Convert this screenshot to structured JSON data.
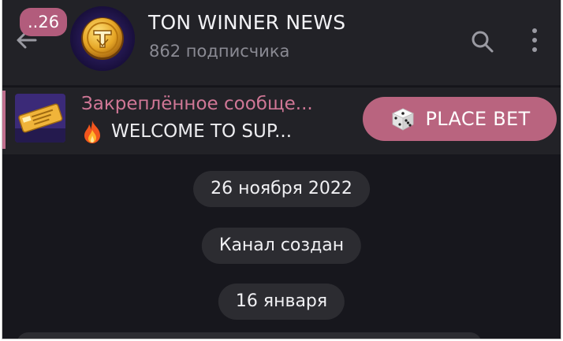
{
  "header": {
    "unread_count": "..26",
    "channel_title": "TON WINNER NEWS",
    "subscribers": "862 подписчика",
    "icons": {
      "back": "arrow-left-icon",
      "search": "search-icon",
      "menu": "more-vertical-icon"
    }
  },
  "pinned": {
    "label": "Закреплённое сообще...",
    "text": "WELCOME TO SUP...",
    "emoji_icon": "fire-icon",
    "button_label": "PLACE BET",
    "button_icon": "dice-icon"
  },
  "messages": {
    "service": [
      {
        "text": "26 ноября 2022"
      },
      {
        "text": "Канал создан"
      },
      {
        "text": "16 января"
      }
    ]
  },
  "colors": {
    "header_bg": "#222227",
    "chat_bg": "#17171d",
    "accent_pink": "#b9647f",
    "pinned_label": "#d07796",
    "pill_bg": "#2c2c31"
  }
}
